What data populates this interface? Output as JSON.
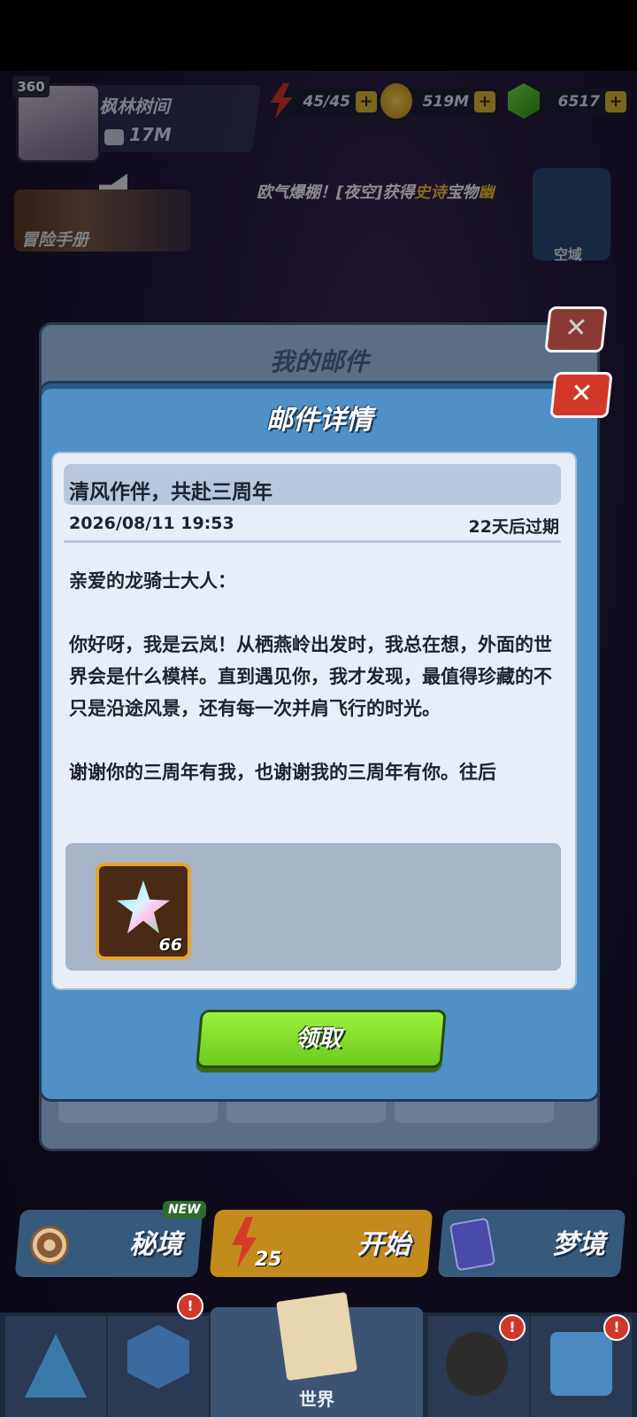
{
  "hud": {
    "level": "360",
    "player_name": "枫林树间",
    "power": "17M",
    "energy": "45/45",
    "gold": "519M",
    "gems": "6517",
    "plus": "+"
  },
  "marquee": {
    "prefix": "欧气爆棚！[夜空]获得",
    "highlight": "史诗",
    "suffix": "宝物",
    "tail": "幽"
  },
  "sidebar": {
    "handbook_label": "冒险手册",
    "sky_label": "空域"
  },
  "back_modal": {
    "title": "我的邮件",
    "close": "✕"
  },
  "mail": {
    "title": "邮件详情",
    "close": "✕",
    "subject": "清风作伴，共赴三周年",
    "date": "2026/08/11 19:53",
    "expire": "22天后过期",
    "body": "亲爱的龙骑士大人：\n\n你好呀，我是云岚！从栖燕岭出发时，我总在想，外面的世界会是什么模样。直到遇见你，我才发现，最值得珍藏的不只是沿途风景，还有每一次并肩飞行的时光。\n\n谢谢你的三周年有我，也谢谢我的三周年有你。往后",
    "reward_count": "66",
    "claim_label": "领取"
  },
  "actions": {
    "secret_label": "秘境",
    "new_badge": "NEW",
    "start_label": "开始",
    "energy_cost": "25",
    "dream_label": "梦境"
  },
  "nav": {
    "world_label": "世界",
    "badge": "!"
  }
}
